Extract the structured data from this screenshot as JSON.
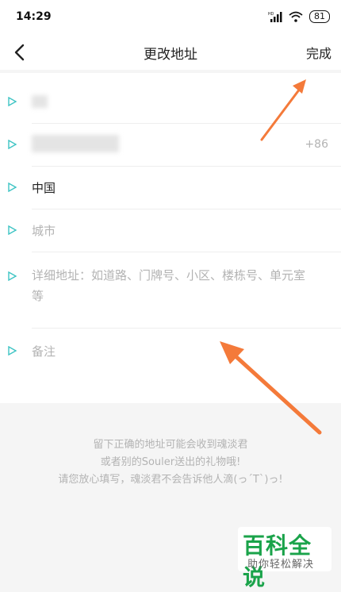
{
  "status_bar": {
    "time": "14:29",
    "battery": "81"
  },
  "nav": {
    "title": "更改地址",
    "done": "完成"
  },
  "form": {
    "country": "中国",
    "area_code": "+86",
    "city_placeholder": "城市",
    "detail_placeholder": "详细地址：如道路、门牌号、小区、楼栋号、单元室等",
    "note_placeholder": "备注"
  },
  "info": {
    "line1": "留下正确的地址可能会收到魂淡君",
    "line2": "或者别的Souler送出的礼物哦!",
    "line3": "请您放心填写，魂淡君不会告诉他人滴(っ´Т`)っ!"
  },
  "watermark": {
    "main": "百科全说",
    "sub": "助你轻松解决"
  },
  "colors": {
    "accent": "#3ec4c4",
    "annotation_arrow": "#f47a3a"
  }
}
